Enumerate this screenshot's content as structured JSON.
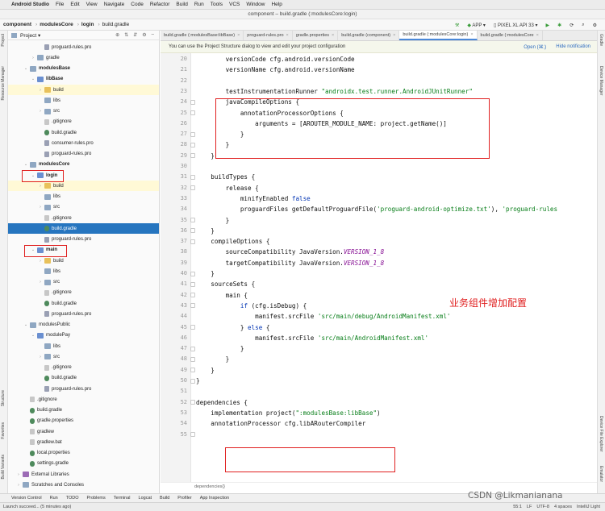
{
  "menubar": {
    "apple": "",
    "items": [
      "Android Studio",
      "File",
      "Edit",
      "View",
      "Navigate",
      "Code",
      "Refactor",
      "Build",
      "Run",
      "Tools",
      "VCS",
      "Window",
      "Help"
    ]
  },
  "titlebar": {
    "title": "component – build.gradle (:modulesCore:login)"
  },
  "navbar": {
    "crumbs": [
      "component",
      "modulesCore",
      "login",
      "build.gradle"
    ],
    "run_config": "APP",
    "device": "PIXEL XL API 33"
  },
  "project_panel": {
    "title": "Project",
    "tree": [
      {
        "label": "proguard-rules.pro",
        "icon": "pro",
        "indent": 2
      },
      {
        "label": "gradle",
        "icon": "folder",
        "indent": 1,
        "arrow": "›"
      },
      {
        "label": "modulesBase",
        "icon": "folder",
        "indent": 0,
        "arrow": "⌄",
        "bold": true
      },
      {
        "label": "libBase",
        "icon": "folder-b",
        "indent": 1,
        "arrow": "⌄",
        "bold": true
      },
      {
        "label": "build",
        "icon": "folder-y",
        "indent": 2,
        "arrow": "›",
        "hl": true
      },
      {
        "label": "libs",
        "icon": "folder",
        "indent": 2
      },
      {
        "label": "src",
        "icon": "folder",
        "indent": 2,
        "arrow": "›"
      },
      {
        "label": ".gitignore",
        "icon": "file",
        "indent": 2
      },
      {
        "label": "build.gradle",
        "icon": "gradle",
        "indent": 2
      },
      {
        "label": "consumer-rules.pro",
        "icon": "pro",
        "indent": 2
      },
      {
        "label": "proguard-rules.pro",
        "icon": "pro",
        "indent": 2
      },
      {
        "label": "modulesCore",
        "icon": "folder",
        "indent": 0,
        "arrow": "⌄",
        "bold": true
      },
      {
        "label": "login",
        "icon": "folder-b",
        "indent": 1,
        "arrow": "⌄",
        "bold": true
      },
      {
        "label": "build",
        "icon": "folder-y",
        "indent": 2,
        "arrow": "›",
        "hl": true
      },
      {
        "label": "libs",
        "icon": "folder",
        "indent": 2
      },
      {
        "label": "src",
        "icon": "folder",
        "indent": 2,
        "arrow": "›"
      },
      {
        "label": ".gitignore",
        "icon": "file",
        "indent": 2
      },
      {
        "label": "build.gradle",
        "icon": "gradle",
        "indent": 2,
        "sel": true
      },
      {
        "label": "proguard-rules.pro",
        "icon": "pro",
        "indent": 2
      },
      {
        "label": "main",
        "icon": "folder-b",
        "indent": 1,
        "arrow": "⌄",
        "bold": true
      },
      {
        "label": "build",
        "icon": "folder-y",
        "indent": 2,
        "arrow": "›"
      },
      {
        "label": "libs",
        "icon": "folder",
        "indent": 2
      },
      {
        "label": "src",
        "icon": "folder",
        "indent": 2,
        "arrow": "›"
      },
      {
        "label": ".gitignore",
        "icon": "file",
        "indent": 2
      },
      {
        "label": "build.gradle",
        "icon": "gradle",
        "indent": 2
      },
      {
        "label": "proguard-rules.pro",
        "icon": "pro",
        "indent": 2
      },
      {
        "label": "modulesPublic",
        "icon": "folder",
        "indent": 0,
        "arrow": "⌄"
      },
      {
        "label": "modulePay",
        "icon": "folder-b",
        "indent": 1,
        "arrow": "⌄"
      },
      {
        "label": "libs",
        "icon": "folder",
        "indent": 2
      },
      {
        "label": "src",
        "icon": "folder",
        "indent": 2,
        "arrow": "›"
      },
      {
        "label": ".gitignore",
        "icon": "file",
        "indent": 2
      },
      {
        "label": "build.gradle",
        "icon": "gradle",
        "indent": 2
      },
      {
        "label": "proguard-rules.pro",
        "icon": "pro",
        "indent": 2
      },
      {
        "label": ".gitignore",
        "icon": "file",
        "indent": 0
      },
      {
        "label": "build.gradle",
        "icon": "gradle",
        "indent": 0
      },
      {
        "label": "gradle.properties",
        "icon": "gradle",
        "indent": 0
      },
      {
        "label": "gradlew",
        "icon": "file",
        "indent": 0
      },
      {
        "label": "gradlew.bat",
        "icon": "file",
        "indent": 0
      },
      {
        "label": "local.properties",
        "icon": "gradle",
        "indent": 0
      },
      {
        "label": "settings.gradle",
        "icon": "gradle",
        "indent": 0
      },
      {
        "label": "External Libraries",
        "icon": "lib",
        "indent": -1,
        "arrow": "›"
      },
      {
        "label": "Scratches and Consoles",
        "icon": "folder",
        "indent": -1,
        "arrow": "›"
      }
    ]
  },
  "left_strip": [
    "Project",
    "Resource Manager",
    "Structure",
    "Favorites",
    "Build Variants"
  ],
  "right_strip": [
    "Gradle",
    "Device Manager",
    "Device File Explorer",
    "Emulator"
  ],
  "tabs": [
    {
      "label": "build.gradle (:modulesBase:libBase)",
      "active": false
    },
    {
      "label": "proguard-rules.pro",
      "active": false
    },
    {
      "label": "gradle.properties",
      "active": false
    },
    {
      "label": "build.gradle (component)",
      "active": false
    },
    {
      "label": "build.gradle (:modulesCore:login)",
      "active": true
    },
    {
      "label": "build.gradle (:modulesCore",
      "active": false
    }
  ],
  "notification": {
    "text": "You can use the Project Structure dialog to view and edit your project configuration",
    "open_label": "Open (⌘;)",
    "hide_label": "Hide notification"
  },
  "editor": {
    "lines": [
      {
        "n": "20",
        "html": "        versionCode cfg.android.versionCode"
      },
      {
        "n": "21",
        "html": "        versionName cfg.android.versionName"
      },
      {
        "n": "22",
        "html": ""
      },
      {
        "n": "23",
        "html": "        testInstrumentationRunner <s>\"androidx.test.runner.AndroidJUnitRunner\"</s>"
      },
      {
        "n": "24",
        "html": "        javaCompileOptions {"
      },
      {
        "n": "25",
        "html": "            annotationProcessorOptions {"
      },
      {
        "n": "26",
        "html": "                arguments = [AROUTER_MODULE_NAME: project.getName()]"
      },
      {
        "n": "27",
        "html": "            }"
      },
      {
        "n": "28",
        "html": "        }"
      },
      {
        "n": "29",
        "html": "    }"
      },
      {
        "n": "30",
        "html": ""
      },
      {
        "n": "31",
        "html": "    buildTypes {"
      },
      {
        "n": "32",
        "html": "        release {"
      },
      {
        "n": "33",
        "html": "            minifyEnabled <k>false</k>"
      },
      {
        "n": "34",
        "html": "            proguardFiles getDefaultProguardFile(<s>'proguard-android-optimize.txt'</s>), <s>'proguard-rules</s>"
      },
      {
        "n": "35",
        "html": "        }"
      },
      {
        "n": "36",
        "html": "    }"
      },
      {
        "n": "37",
        "html": "    compileOptions {"
      },
      {
        "n": "38",
        "html": "        sourceCompatibility JavaVersion.<c>VERSION_1_8</c>"
      },
      {
        "n": "39",
        "html": "        targetCompatibility JavaVersion.<c>VERSION_1_8</c>"
      },
      {
        "n": "40",
        "html": "    }"
      },
      {
        "n": "41",
        "html": "    sourceSets {"
      },
      {
        "n": "42",
        "html": "        main {"
      },
      {
        "n": "43",
        "html": "            <k>if</k> (cfg.isDebug) {"
      },
      {
        "n": "44",
        "html": "                manifest.srcFile <s>'src/main/debug/AndroidManifest.xml'</s>"
      },
      {
        "n": "45",
        "html": "            } <k>else</k> {"
      },
      {
        "n": "46",
        "html": "                manifest.srcFile <s>'src/main/AndroidManifest.xml'</s>"
      },
      {
        "n": "47",
        "html": "            }"
      },
      {
        "n": "48",
        "html": "        }"
      },
      {
        "n": "49",
        "html": "    }"
      },
      {
        "n": "50",
        "html": "}"
      },
      {
        "n": "51",
        "html": ""
      },
      {
        "n": "52",
        "html": "dependencies {"
      },
      {
        "n": "53",
        "html": "    implementation project(<s>\":modulesBase:libBase\"</s>)"
      },
      {
        "n": "54",
        "html": "    annotationProcessor cfg.libARouterCompiler"
      },
      {
        "n": "55",
        "html": ""
      }
    ],
    "annotation": "业务组件增加配置",
    "breadcrumb": "dependencies{}"
  },
  "toolwindows": [
    "Version Control",
    "Run",
    "TODO",
    "Problems",
    "Terminal",
    "Logcat",
    "Build",
    "Profiler",
    "App Inspection"
  ],
  "status": {
    "message": "Launch succeed... (5 minutes ago)",
    "right": [
      "55:1",
      "LF",
      "UTF-8",
      "4 spaces",
      "IntelliJ Light"
    ]
  },
  "watermark": "CSDN @Likmanianana"
}
